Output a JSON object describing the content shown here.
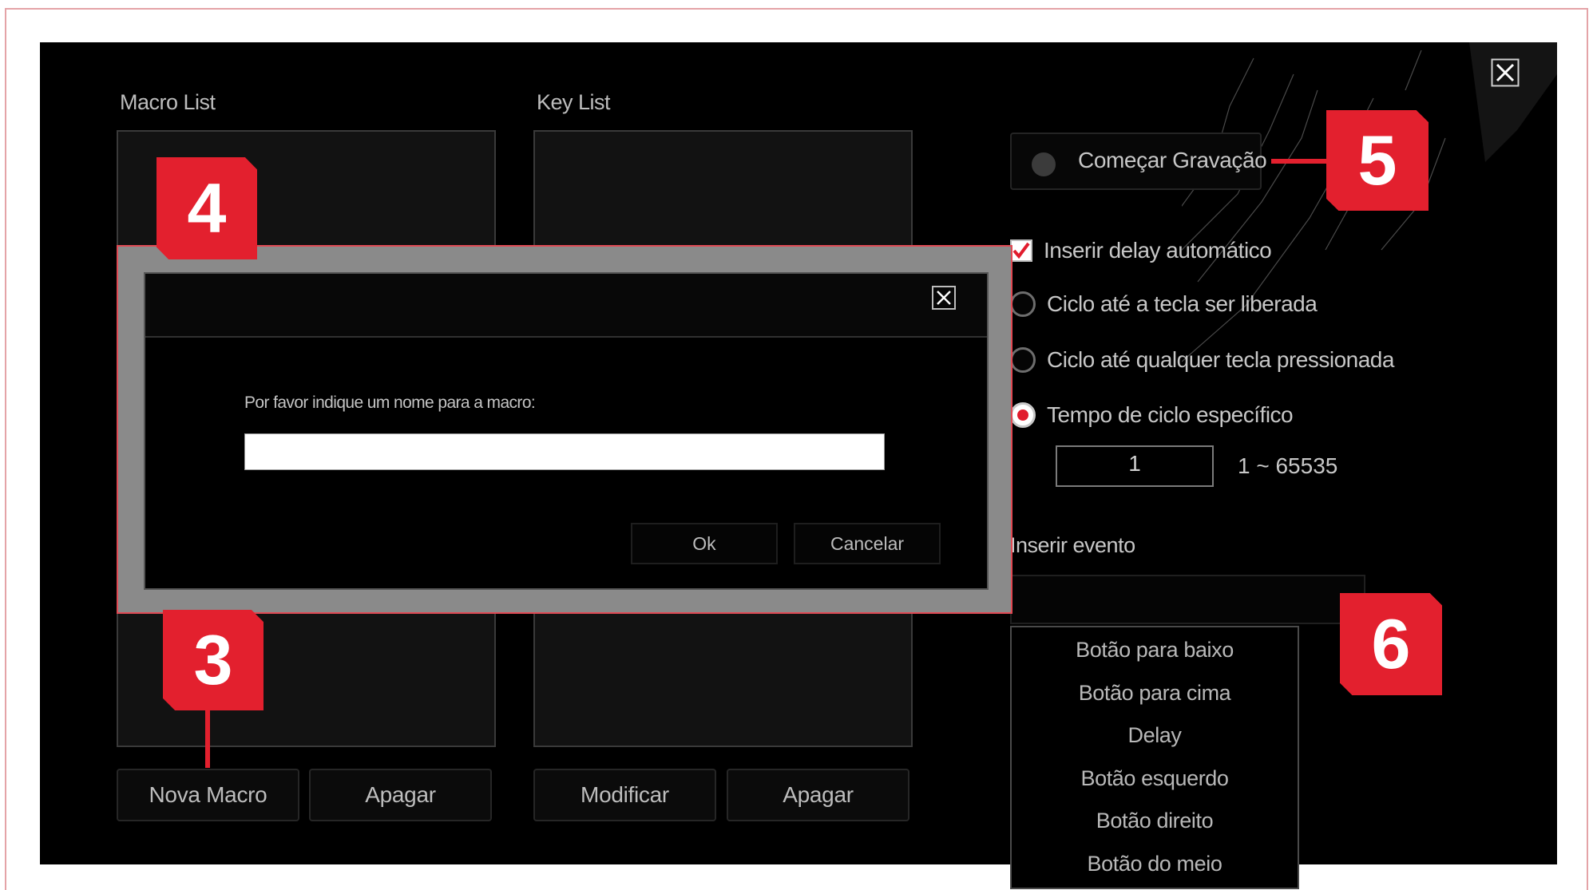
{
  "macro_list": {
    "label": "Macro List",
    "new_button": "Nova Macro",
    "delete_button": "Apagar"
  },
  "key_list": {
    "label": "Key List",
    "modify_button": "Modificar",
    "delete_button": "Apagar"
  },
  "recording": {
    "start_label": "Começar Gravação"
  },
  "options": {
    "auto_delay": {
      "label": "Inserir delay automático",
      "checked": true
    },
    "loop_until_release": {
      "label": "Ciclo até a tecla ser liberada",
      "selected": false
    },
    "loop_until_any_key": {
      "label": "Ciclo até qualquer tecla pressionada",
      "selected": false
    },
    "loop_specific": {
      "label": "Tempo de ciclo específico",
      "selected": true
    }
  },
  "cycle": {
    "value": "1",
    "range": "1 ~ 65535"
  },
  "insert_event": {
    "label": "Inserir evento",
    "dropdown_items": [
      "Botão para baixo",
      "Botão para cima",
      "Delay",
      "Botão esquerdo",
      "Botão direito",
      "Botão do meio"
    ]
  },
  "dialog": {
    "prompt": "Por favor indique um nome para a macro:",
    "input_value": "",
    "ok_label": "Ok",
    "cancel_label": "Cancelar"
  },
  "callouts": {
    "c3": "3",
    "c4": "4",
    "c5": "5",
    "c6": "6"
  },
  "colors": {
    "accent_red": "#e3202e",
    "background": "#000000",
    "text": "#c7c7c7"
  },
  "icons": [
    "close-icon",
    "record-dot-icon",
    "checkmark-icon",
    "radio-icon"
  ]
}
